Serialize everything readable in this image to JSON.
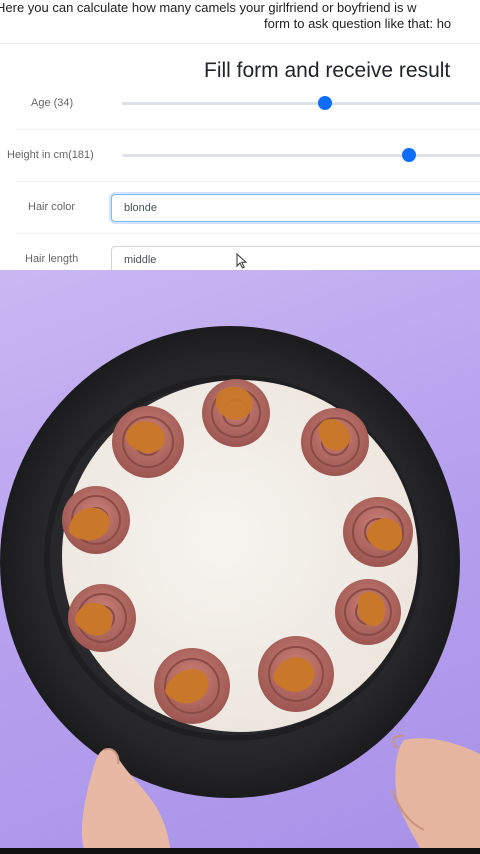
{
  "intro": {
    "line1": "Here you can calculate how many camels your girlfriend or boyfriend is w",
    "line2": "form to ask question like that: ho"
  },
  "form": {
    "title": "Fill form and receive result",
    "fields": [
      {
        "label": "Age (34)",
        "type": "slider",
        "value": 34
      },
      {
        "label": "Height in cm(181)",
        "type": "slider",
        "value": 181
      },
      {
        "label": "Hair color",
        "type": "text",
        "value": "blonde"
      },
      {
        "label": "Hair length",
        "type": "text",
        "value": "middle"
      }
    ]
  },
  "colors": {
    "accent": "#0d6efd",
    "video_background": "#b7a2ef",
    "turntable": "#2a2a2d",
    "cake_top": "#f3efea",
    "cream": "#b06a62",
    "caramel": "#c9782a"
  },
  "icons": {
    "cursor": "mouse-pointer-icon"
  }
}
